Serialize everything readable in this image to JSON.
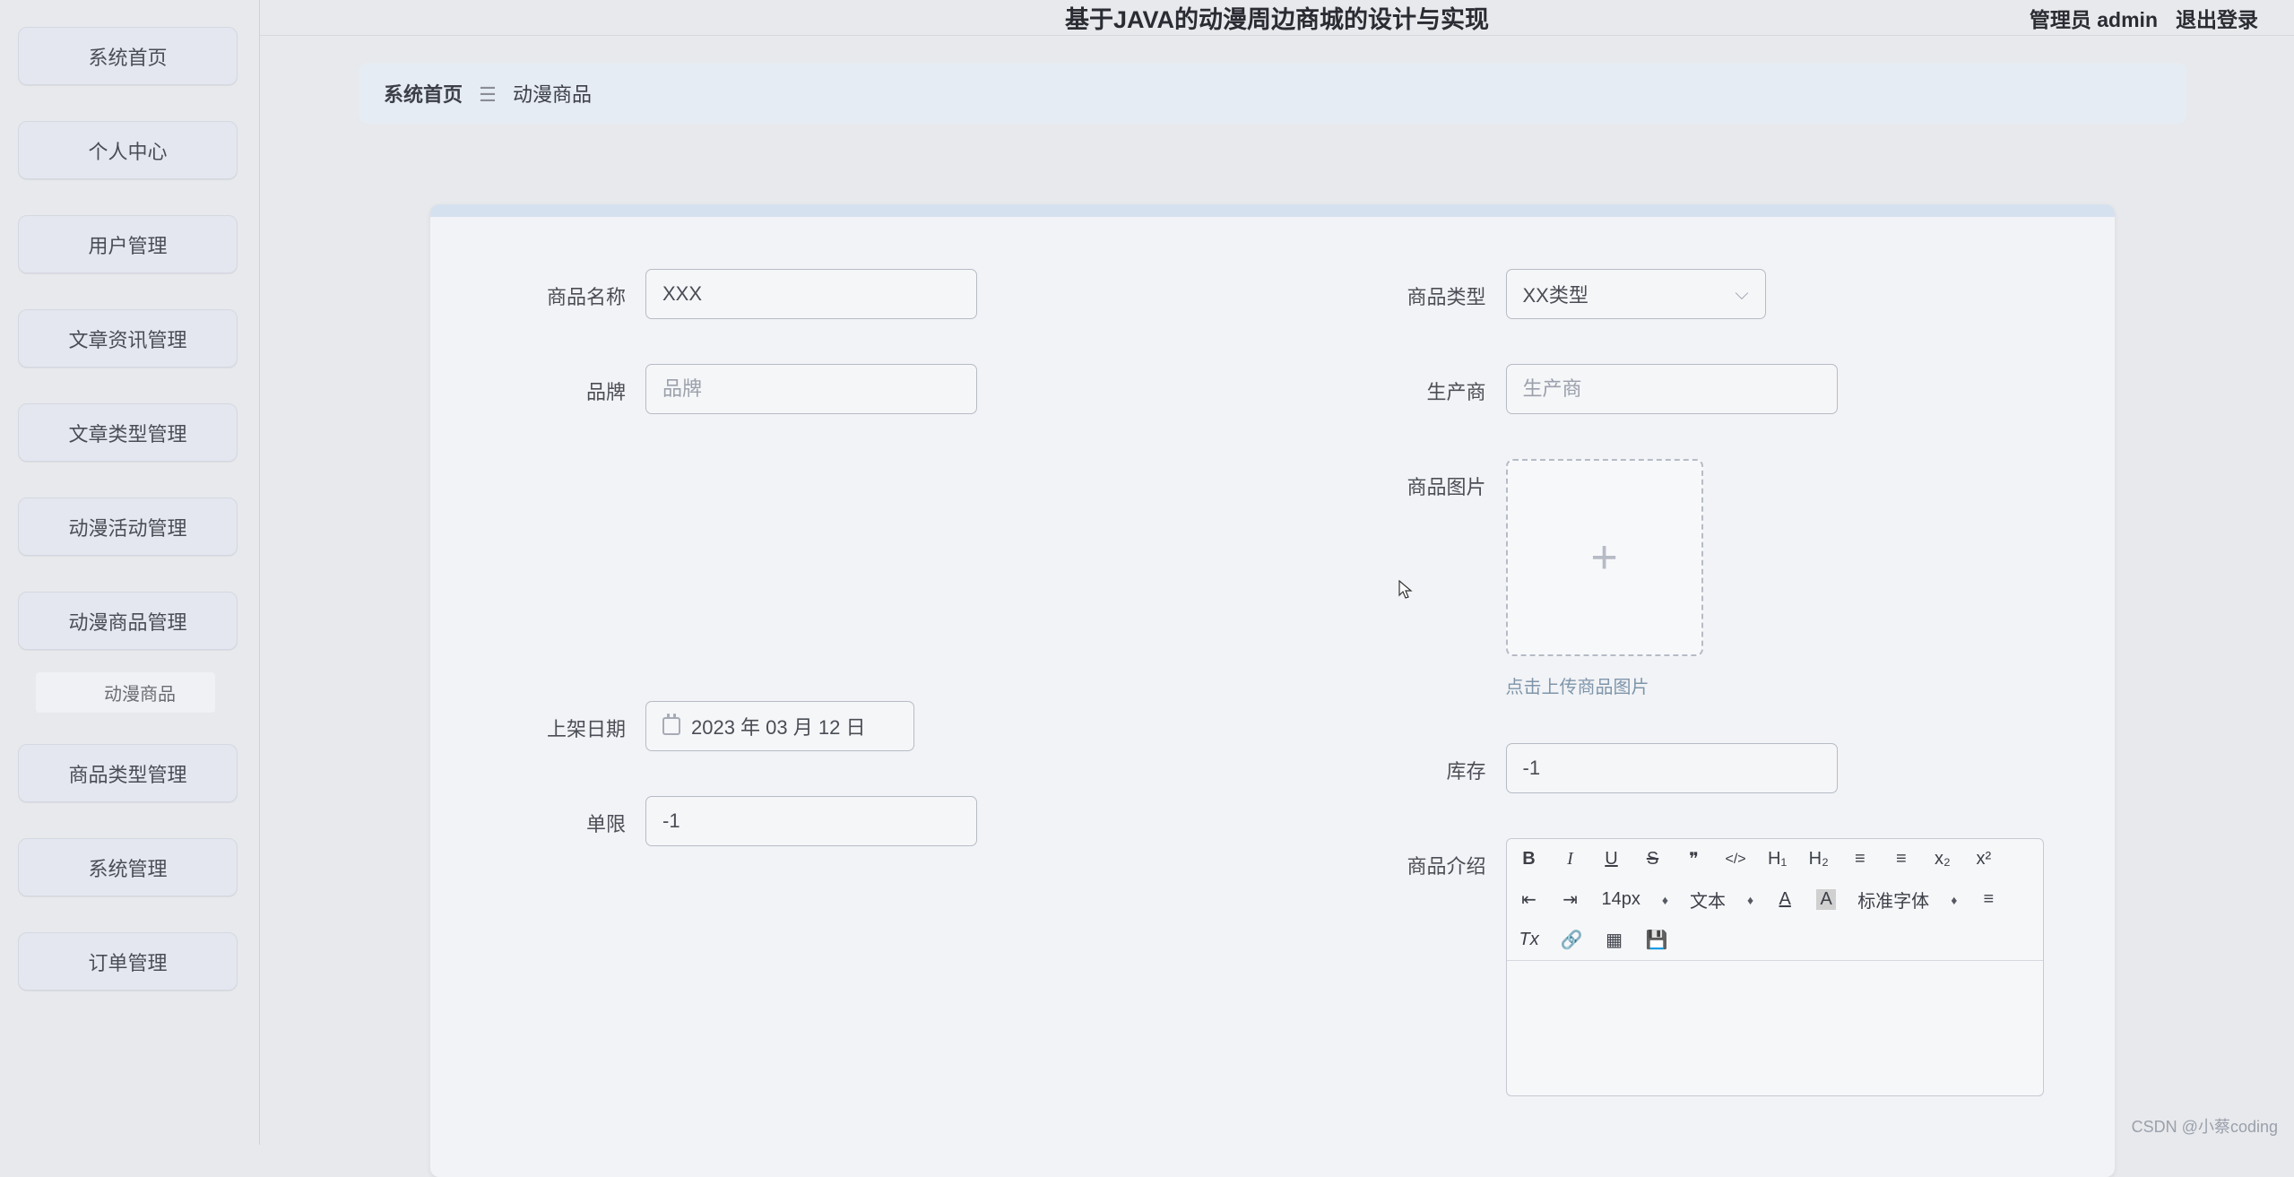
{
  "header": {
    "title": "基于JAVA的动漫周边商城的设计与实现",
    "user_label": "管理员 admin",
    "logout_label": "退出登录"
  },
  "sidebar": {
    "items": [
      {
        "label": "系统首页"
      },
      {
        "label": "个人中心"
      },
      {
        "label": "用户管理"
      },
      {
        "label": "文章资讯管理"
      },
      {
        "label": "文章类型管理"
      },
      {
        "label": "动漫活动管理"
      },
      {
        "label": "动漫商品管理"
      },
      {
        "label": "商品类型管理"
      },
      {
        "label": "系统管理"
      },
      {
        "label": "订单管理"
      }
    ],
    "sub_item": "动漫商品"
  },
  "breadcrumb": {
    "home": "系统首页",
    "separator": "☰",
    "current": "动漫商品"
  },
  "form": {
    "product_name": {
      "label": "商品名称",
      "value": "XXX"
    },
    "brand": {
      "label": "品牌",
      "placeholder": "品牌",
      "value": ""
    },
    "listing_date": {
      "label": "上架日期",
      "value": "2023 年 03 月 12 日"
    },
    "single_limit": {
      "label": "单限",
      "value": "-1"
    },
    "product_type": {
      "label": "商品类型",
      "value": "XX类型"
    },
    "manufacturer": {
      "label": "生产商",
      "placeholder": "生产商",
      "value": ""
    },
    "product_image": {
      "label": "商品图片",
      "hint": "点击上传商品图片"
    },
    "stock": {
      "label": "库存",
      "value": "-1"
    },
    "description": {
      "label": "商品介绍"
    }
  },
  "editor": {
    "font_size": "14px",
    "text_style": "文本",
    "font_family": "标准字体",
    "icons": {
      "bold": "B",
      "italic": "I",
      "underline": "U",
      "strike": "S",
      "quote": "❞",
      "code": "</>",
      "h1": "H₁",
      "h2": "H₂",
      "ol": "≡",
      "ul": "≡",
      "sub": "x₂",
      "sup": "x²",
      "outdent": "⇤",
      "indent": "⇥",
      "fontcolor": "A",
      "bgcolor": "A",
      "align": "≡",
      "clear": "Tx",
      "link": "🔗",
      "image": "▦",
      "save": "💾"
    }
  },
  "watermark": "CSDN @小蔡coding"
}
